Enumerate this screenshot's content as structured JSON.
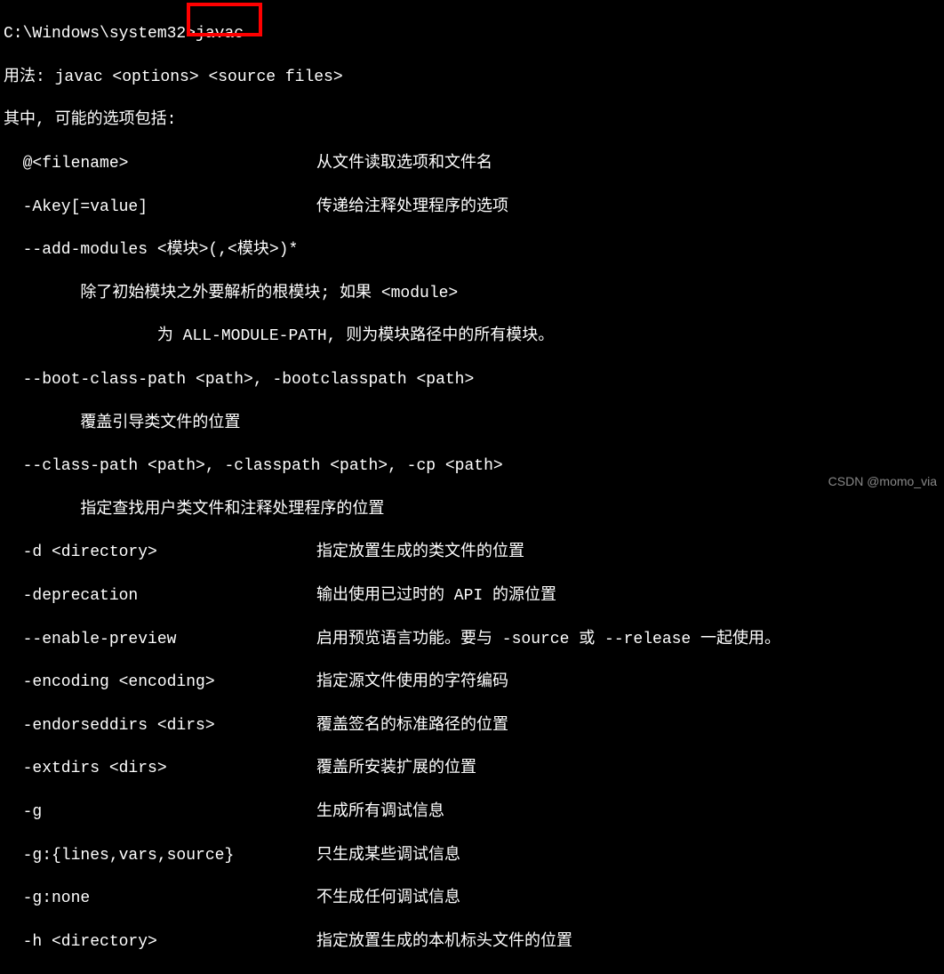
{
  "terminal": {
    "prompt": "C:\\Windows\\system32>",
    "command": "javac",
    "usage_label": "用法: ",
    "usage_cmd": "javac <options> <source files>",
    "options_intro": "其中, 可能的选项包括:",
    "options": [
      {
        "flag": "  @<filename>",
        "desc": "从文件读取选项和文件名"
      },
      {
        "flag": "  -Akey[=value]",
        "desc": "传递给注释处理程序的选项"
      },
      {
        "flag": "  --add-modules <模块>(,<模块>)*",
        "desc": ""
      },
      {
        "flag": "",
        "desc_full": "        除了初始模块之外要解析的根模块; 如果 <module>"
      },
      {
        "flag": "",
        "desc_full": "                为 ALL-MODULE-PATH, 则为模块路径中的所有模块。"
      },
      {
        "flag": "  --boot-class-path <path>, -bootclasspath <path>",
        "desc": ""
      },
      {
        "flag": "",
        "desc_full": "        覆盖引导类文件的位置"
      },
      {
        "flag": "  --class-path <path>, -classpath <path>, -cp <path>",
        "desc": ""
      },
      {
        "flag": "",
        "desc_full": "        指定查找用户类文件和注释处理程序的位置"
      },
      {
        "flag": "  -d <directory>",
        "desc": "指定放置生成的类文件的位置"
      },
      {
        "flag": "  -deprecation",
        "desc": "输出使用已过时的 API 的源位置"
      },
      {
        "flag": "  --enable-preview",
        "desc": "启用预览语言功能。要与 -source 或 --release 一起使用。"
      },
      {
        "flag": "  -encoding <encoding>",
        "desc": "指定源文件使用的字符编码"
      },
      {
        "flag": "  -endorseddirs <dirs>",
        "desc": "覆盖签名的标准路径的位置"
      },
      {
        "flag": "  -extdirs <dirs>",
        "desc": "覆盖所安装扩展的位置"
      },
      {
        "flag": "  -g",
        "desc": "生成所有调试信息"
      },
      {
        "flag": "  -g:{lines,vars,source}",
        "desc": "只生成某些调试信息"
      },
      {
        "flag": "  -g:none",
        "desc": "不生成任何调试信息"
      },
      {
        "flag": "  -h <directory>",
        "desc": "指定放置生成的本机标头文件的位置"
      }
    ]
  },
  "annotation": {
    "highlighted_command": "javac"
  },
  "watermark": "CSDN @momo_via"
}
